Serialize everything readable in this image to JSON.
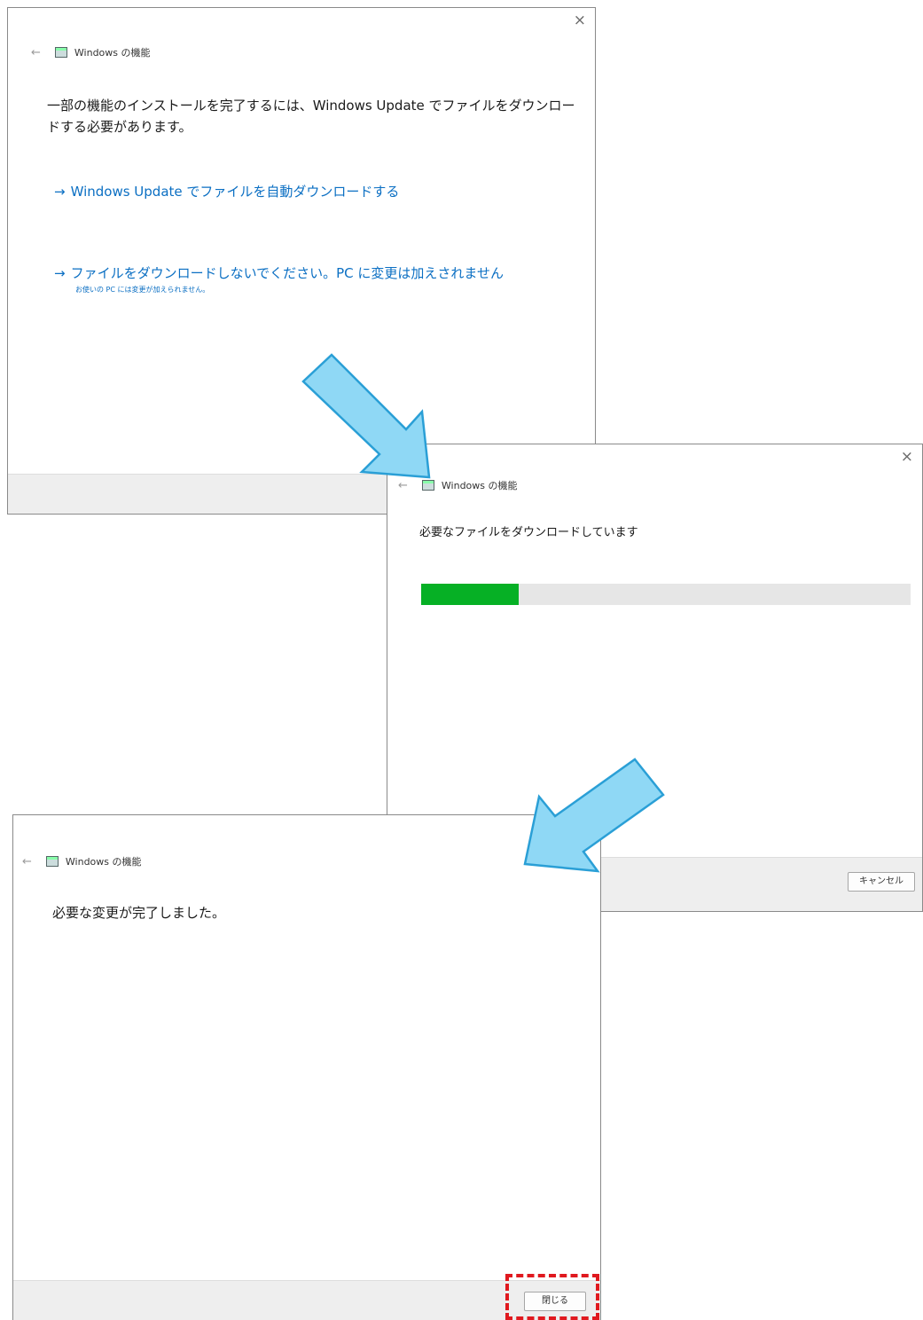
{
  "windows": {
    "first": {
      "title": "Windows の機能",
      "message": "一部の機能のインストールを完了するには、Windows Update でファイルをダウンロードする必要があります。",
      "option1": "Windows Update でファイルを自動ダウンロードする",
      "option2": "ファイルをダウンロードしないでください。PC に変更は加えされません",
      "option2_note": "お使いの PC には変更が加えられません。"
    },
    "second": {
      "title": "Windows の機能",
      "message": "必要なファイルをダウンロードしています",
      "progress_percent": 20,
      "cancel_label": "キャンセル"
    },
    "third": {
      "title": "Windows の機能",
      "message": "必要な変更が完了しました。",
      "close_label": "閉じる"
    }
  },
  "glyphs": {
    "close": "×",
    "back": "←",
    "link_arrow": "→"
  },
  "colors": {
    "link": "#0b6fc3",
    "progress": "#06b025",
    "callout_arrow": "#8fd8f5",
    "highlight": "#e0191f"
  }
}
